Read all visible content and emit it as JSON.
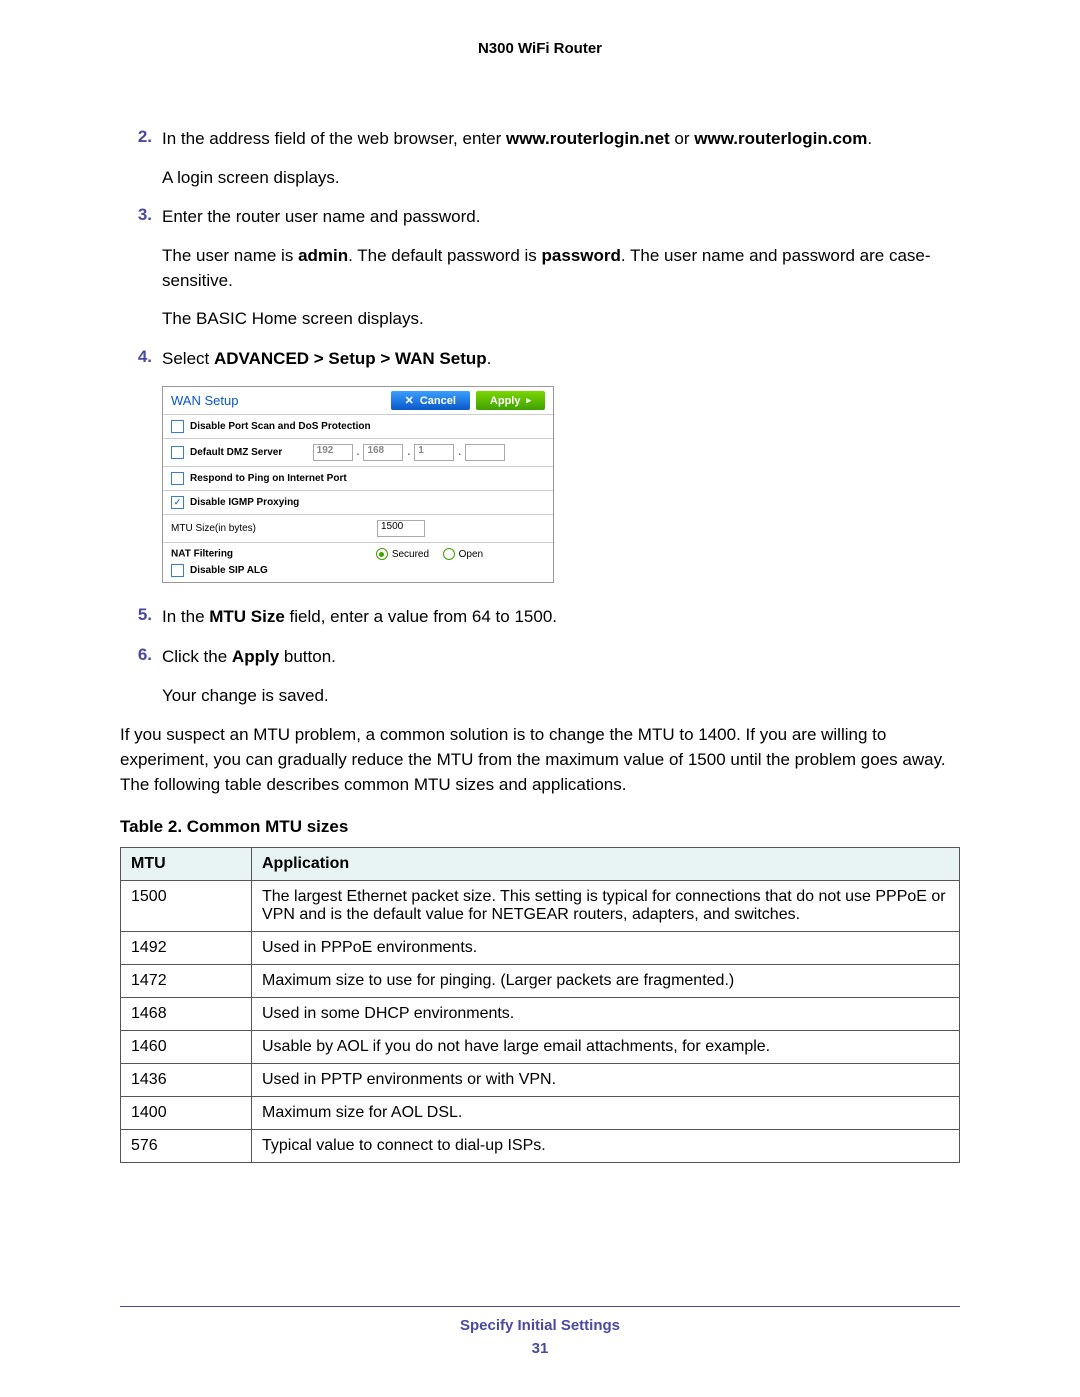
{
  "header": {
    "product": "N300 WiFi Router"
  },
  "steps": {
    "s2": {
      "num": "2.",
      "lines": [
        "In the address field of the web browser, enter <b>www.routerlogin.net</b> or <b>www.routerlogin.com</b>.",
        "A login screen displays."
      ]
    },
    "s3": {
      "num": "3.",
      "lines": [
        "Enter the router user name and password.",
        "The user name is <b>admin</b>. The default password is <b>password</b>. The user name and password are case-sensitive.",
        "The BASIC Home screen displays."
      ]
    },
    "s4": {
      "num": "4.",
      "lines": [
        "Select <b>ADVANCED > Setup > WAN Setup</b>."
      ]
    },
    "s5": {
      "num": "5.",
      "lines": [
        "In the <b>MTU Size</b> field, enter a value from 64 to 1500."
      ]
    },
    "s6": {
      "num": "6.",
      "lines": [
        "Click the <b>Apply</b> button.",
        "Your change is saved."
      ]
    }
  },
  "wan": {
    "title": "WAN Setup",
    "cancel": "Cancel",
    "apply": "Apply",
    "rows": {
      "portscan": "Disable Port Scan and DoS Protection",
      "dmz": "Default DMZ Server",
      "ip": [
        "192",
        "168",
        "1",
        ""
      ],
      "ping": "Respond to Ping on Internet Port",
      "igmp": "Disable IGMP Proxying",
      "mtu_label": "MTU Size(in bytes)",
      "mtu_value": "1500",
      "nat": "NAT Filtering",
      "secured": "Secured",
      "open": "Open",
      "sip": "Disable SIP ALG"
    }
  },
  "body_para": "If you suspect an MTU problem, a common solution is to change the MTU to 1400. If you are willing to experiment, you can gradually reduce the MTU from the maximum value of 1500 until the problem goes away. The following table describes common MTU sizes and applications.",
  "table": {
    "caption": "Table 2.  Common MTU sizes",
    "headers": [
      "MTU",
      "Application"
    ],
    "rows": [
      [
        "1500",
        "The largest Ethernet packet size. This setting is typical for connections that do not use PPPoE or VPN and is the default value for NETGEAR routers, adapters, and switches."
      ],
      [
        "1492",
        "Used in PPPoE environments."
      ],
      [
        "1472",
        "Maximum size to use for pinging. (Larger packets are fragmented.)"
      ],
      [
        "1468",
        "Used in some DHCP environments."
      ],
      [
        "1460",
        "Usable by AOL if you do not have large email attachments, for example."
      ],
      [
        "1436",
        "Used in PPTP environments or with VPN."
      ],
      [
        "1400",
        "Maximum size for AOL DSL."
      ],
      [
        "576",
        "Typical value to connect to dial-up ISPs."
      ]
    ]
  },
  "footer": {
    "section": "Specify Initial Settings",
    "page": "31"
  }
}
